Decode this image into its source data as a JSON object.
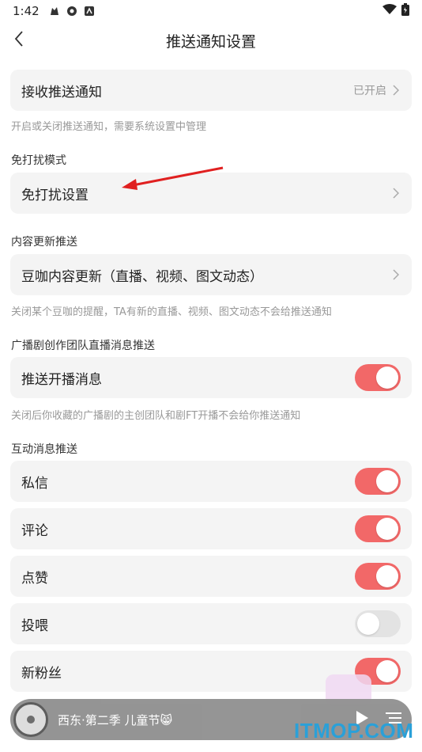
{
  "status_bar": {
    "time": "1:42"
  },
  "nav": {
    "title": "推送通知设置"
  },
  "receive": {
    "label": "接收推送通知",
    "value": "已开启",
    "hint": "开启或关闭推送通知，需要系统设置中管理"
  },
  "dnd": {
    "section": "免打扰模式",
    "label": "免打扰设置"
  },
  "content": {
    "section": "内容更新推送",
    "label": "豆咖内容更新（直播、视频、图文动态）",
    "hint": "关闭某个豆咖的提醒，TA有新的直播、视频、图文动态不会给推送通知"
  },
  "broadcast": {
    "section": "广播剧创作团队直播消息推送",
    "label": "推送开播消息",
    "hint": "关闭后你收藏的广播剧的主创团队和剧FT开播不会给你推送通知",
    "enabled": true
  },
  "interaction": {
    "section": "互动消息推送",
    "items": [
      {
        "label": "私信",
        "enabled": true
      },
      {
        "label": "评论",
        "enabled": true
      },
      {
        "label": "点赞",
        "enabled": true
      },
      {
        "label": "投喂",
        "enabled": false
      },
      {
        "label": "新粉丝",
        "enabled": true
      }
    ]
  },
  "player": {
    "title": "西东·第二季 儿童节😸"
  },
  "watermark": "ITMOP.COM",
  "colors": {
    "toggle_on": "#f26868",
    "toggle_off": "#e3e3e3",
    "card_bg": "#f4f4f4",
    "annotation_arrow": "#e02020"
  }
}
